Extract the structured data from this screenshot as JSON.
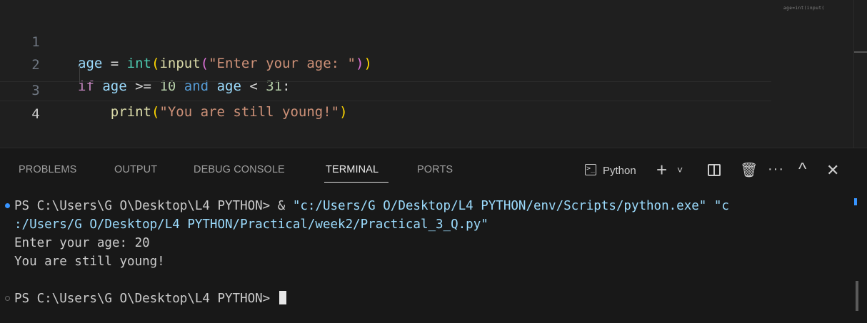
{
  "editor": {
    "line_numbers": [
      "1",
      "2",
      "3",
      "4"
    ],
    "lines": [
      {
        "segments": [
          {
            "text": "age",
            "cls": "var"
          },
          {
            "text": " = ",
            "cls": "op"
          },
          {
            "text": "int",
            "cls": "bi"
          },
          {
            "text": "(",
            "cls": "br1"
          },
          {
            "text": "input",
            "cls": "fn"
          },
          {
            "text": "(",
            "cls": "br2"
          },
          {
            "text": "\"Enter your age: \"",
            "cls": "str"
          },
          {
            "text": ")",
            "cls": "br2"
          },
          {
            "text": ")",
            "cls": "br1"
          }
        ]
      },
      {
        "segments": [
          {
            "text": "if",
            "cls": "kw"
          },
          {
            "text": " ",
            "cls": "op"
          },
          {
            "text": "age",
            "cls": "var"
          },
          {
            "text": " >= ",
            "cls": "op"
          },
          {
            "text": "10",
            "cls": "num"
          },
          {
            "text": " ",
            "cls": "op"
          },
          {
            "text": "and",
            "cls": "and"
          },
          {
            "text": " ",
            "cls": "op"
          },
          {
            "text": "age",
            "cls": "var"
          },
          {
            "text": " < ",
            "cls": "op"
          },
          {
            "text": "31",
            "cls": "num"
          },
          {
            "text": ":",
            "cls": "op"
          }
        ]
      },
      {
        "segments": [
          {
            "text": "    ",
            "cls": "op"
          },
          {
            "text": "print",
            "cls": "fn"
          },
          {
            "text": "(",
            "cls": "br1"
          },
          {
            "text": "\"You are still young!\"",
            "cls": "str"
          },
          {
            "text": ")",
            "cls": "br1"
          }
        ]
      },
      {
        "segments": []
      }
    ],
    "minimap_text": "age=int(input("
  },
  "panel": {
    "tabs": [
      {
        "label": "PROBLEMS",
        "name": "tab-problems",
        "active": false
      },
      {
        "label": "OUTPUT",
        "name": "tab-output",
        "active": false
      },
      {
        "label": "DEBUG CONSOLE",
        "name": "tab-debug-console",
        "active": false
      },
      {
        "label": "TERMINAL",
        "name": "tab-terminal",
        "active": true
      },
      {
        "label": "PORTS",
        "name": "tab-ports",
        "active": false
      }
    ],
    "toolbar": {
      "terminal_icon": "terminal-icon",
      "terminal_label": "Python",
      "plus": "+",
      "chevron": "˅",
      "trash": "🗑",
      "more": "···",
      "caret_up": "^",
      "close": "✕"
    }
  },
  "terminal": {
    "lines": [
      {
        "segments": [
          {
            "text": "PS C:\\Users\\G O\\Desktop\\L4 PYTHON> & ",
            "cls": ""
          },
          {
            "text": "\"c:/Users/G O/Desktop/L4 PYTHON/env/Scripts/python.exe\" \"c",
            "cls": "path-str"
          }
        ]
      },
      {
        "segments": [
          {
            "text": ":/Users/G O/Desktop/L4 PYTHON/Practical/week2/Practical_3_Q.py\"",
            "cls": "path-str"
          }
        ]
      },
      {
        "segments": [
          {
            "text": "Enter your age: 20",
            "cls": ""
          }
        ]
      },
      {
        "segments": [
          {
            "text": "You are still young!",
            "cls": ""
          }
        ]
      },
      {
        "segments": [
          {
            "text": "PS C:\\Users\\G O\\Desktop\\L4 PYTHON> ",
            "cls": ""
          }
        ]
      }
    ]
  }
}
